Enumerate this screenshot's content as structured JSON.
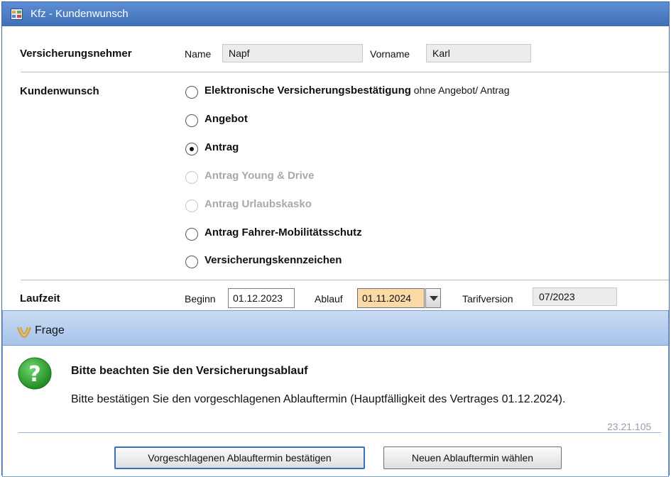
{
  "window": {
    "title": "Kfz - Kundenwunsch"
  },
  "versicherungsnehmer": {
    "label": "Versicherungsnehmer",
    "name_label": "Name",
    "name_value": "Napf",
    "vorname_label": "Vorname",
    "vorname_value": "Karl"
  },
  "kundenwunsch": {
    "label": "Kundenwunsch",
    "options": [
      {
        "label": "Elektronische Versicherungsbestätigung",
        "suffix": " ohne Angebot/ Antrag",
        "checked": false,
        "disabled": false
      },
      {
        "label": "Angebot",
        "suffix": "",
        "checked": false,
        "disabled": false
      },
      {
        "label": "Antrag",
        "suffix": "",
        "checked": true,
        "disabled": false
      },
      {
        "label": "Antrag Young & Drive",
        "suffix": "",
        "checked": false,
        "disabled": true
      },
      {
        "label": "Antrag Urlaubskasko",
        "suffix": "",
        "checked": false,
        "disabled": true
      },
      {
        "label": "Antrag Fahrer-Mobilitätsschutz",
        "suffix": "",
        "checked": false,
        "disabled": false
      },
      {
        "label": "Versicherungskennzeichen",
        "suffix": "",
        "checked": false,
        "disabled": false
      }
    ]
  },
  "laufzeit": {
    "label": "Laufzeit",
    "beginn_label": "Beginn",
    "beginn_value": "01.12.2023",
    "ablauf_label": "Ablauf",
    "ablauf_value": "01.11.2024",
    "tarifversion_label": "Tarifversion",
    "tarifversion_value": "07/2023"
  },
  "dialog": {
    "title": "Frage",
    "message_title": "Bitte beachten Sie den Versicherungsablauf",
    "message_text": "Bitte bestätigen Sie den vorgeschlagenen Ablauftermin (Hauptfälligkeit des Vertrages 01.12.2024).",
    "version": "23.21.105",
    "confirm_button": "Vorgeschlagenen Ablauftermin bestätigen",
    "new_button": "Neuen Ablauftermin wählen"
  },
  "colors": {
    "titlebar": "#4a7cc4",
    "dialog_header": "#b8cfee",
    "highlight_field": "#f9d9a5",
    "question_icon": "#2e9a2e"
  }
}
